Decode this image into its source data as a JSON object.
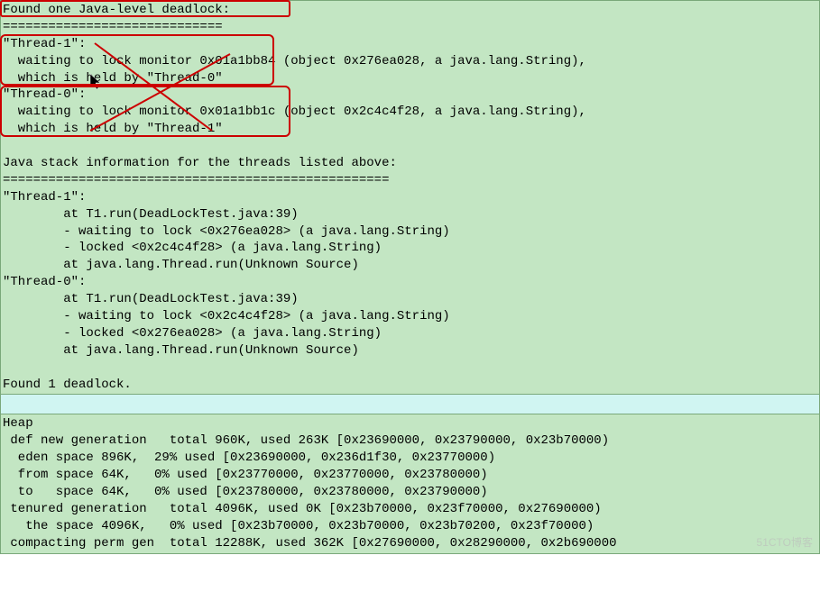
{
  "deadlock_header": {
    "title": "Found one Java-level deadlock:",
    "sep": "============================="
  },
  "deadlock": {
    "t1_name": "\"Thread-1\":",
    "t1_waiting": "  waiting to lock monitor 0x01a1bb84 (object 0x276ea028, a java.lang.String),",
    "t1_held": "  which is held by \"Thread-0\"",
    "t0_name": "\"Thread-0\":",
    "t0_waiting": "  waiting to lock monitor 0x01a1bb1c (object 0x2c4c4f28, a java.lang.String),",
    "t0_held": "  which is held by \"Thread-1\""
  },
  "stack_header": {
    "title": "Java stack information for the threads listed above:",
    "sep": "==================================================="
  },
  "stack": {
    "t1_name": "\"Thread-1\":",
    "t1_l1": "        at T1.run(DeadLockTest.java:39)",
    "t1_l2": "        - waiting to lock <0x276ea028> (a java.lang.String)",
    "t1_l3": "        - locked <0x2c4c4f28> (a java.lang.String)",
    "t1_l4": "        at java.lang.Thread.run(Unknown Source)",
    "t0_name": "\"Thread-0\":",
    "t0_l1": "        at T1.run(DeadLockTest.java:39)",
    "t0_l2": "        - waiting to lock <0x2c4c4f28> (a java.lang.String)",
    "t0_l3": "        - locked <0x276ea028> (a java.lang.String)",
    "t0_l4": "        at java.lang.Thread.run(Unknown Source)"
  },
  "found": "Found 1 deadlock.",
  "heap": {
    "title": "Heap",
    "l1": " def new generation   total 960K, used 263K [0x23690000, 0x23790000, 0x23b70000)",
    "l2": "  eden space 896K,  29% used [0x23690000, 0x236d1f30, 0x23770000)",
    "l3": "  from space 64K,   0% used [0x23770000, 0x23770000, 0x23780000)",
    "l4": "  to   space 64K,   0% used [0x23780000, 0x23780000, 0x23790000)",
    "l5": " tenured generation   total 4096K, used 0K [0x23b70000, 0x23f70000, 0x27690000)",
    "l6": "   the space 4096K,   0% used [0x23b70000, 0x23b70000, 0x23b70200, 0x23f70000)",
    "l7": " compacting perm gen  total 12288K, used 362K [0x27690000, 0x28290000, 0x2b690000"
  },
  "watermark": "51CTO博客"
}
